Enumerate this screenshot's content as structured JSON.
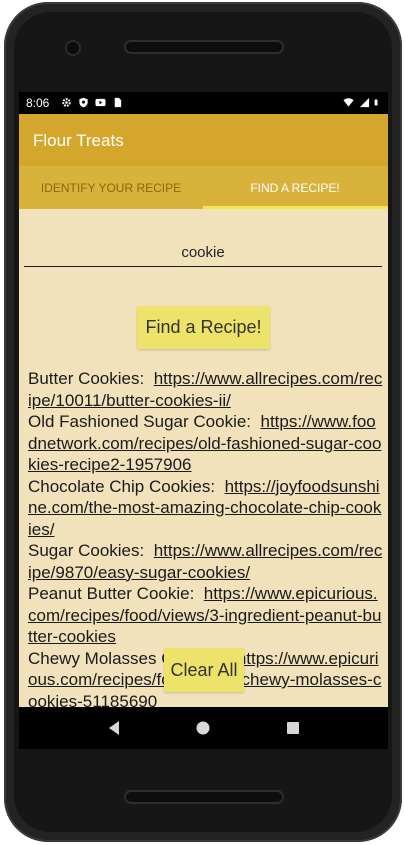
{
  "status": {
    "time": "8:06",
    "left_icons": [
      "gear-icon",
      "shield-icon",
      "youtube-icon",
      "sim-icon"
    ],
    "right_icons": [
      "wifi-icon",
      "signal-icon",
      "battery-icon"
    ]
  },
  "app": {
    "title": "Flour Treats"
  },
  "tabs": [
    {
      "label": "IDENTIFY YOUR RECIPE",
      "active": false
    },
    {
      "label": "FIND A RECIPE!",
      "active": true
    }
  ],
  "search": {
    "value": "cookie"
  },
  "find_button": {
    "label": "Find a Recipe!"
  },
  "results": [
    {
      "name": "Butter Cookies:",
      "url": "https://www.allrecipes.com/recipe/10011/butter-cookies-ii/"
    },
    {
      "name": "Old Fashioned Sugar Cookie:",
      "url": "https://www.foodnetwork.com/recipes/old-fashioned-sugar-cookies-recipe2-1957906"
    },
    {
      "name": "Chocolate Chip Cookies:",
      "url": "https://joyfoodsunshine.com/the-most-amazing-chocolate-chip-cookies/"
    },
    {
      "name": "Sugar Cookies:",
      "url": "https://www.allrecipes.com/recipe/9870/easy-sugar-cookies/"
    },
    {
      "name": "Peanut Butter Cookie:",
      "url": "https://www.epicurious.com/recipes/food/views/3-ingredient-peanut-butter-cookies"
    },
    {
      "name": "Chewy Molasses Cookies:",
      "url": "https://www.epicurious.com/recipes/food/views/chewy-molasses-cookies-51185690"
    }
  ],
  "clear_button": {
    "label": "Clear All"
  },
  "colors": {
    "appbar": "#d4a72c",
    "tabbar": "#d9b23c",
    "tab_indicator": "#f5e84a",
    "content_bg": "#f1e2bc",
    "button_bg": "#ede36a"
  },
  "navbar": {
    "buttons": [
      "back-icon",
      "home-icon",
      "recents-icon"
    ]
  }
}
